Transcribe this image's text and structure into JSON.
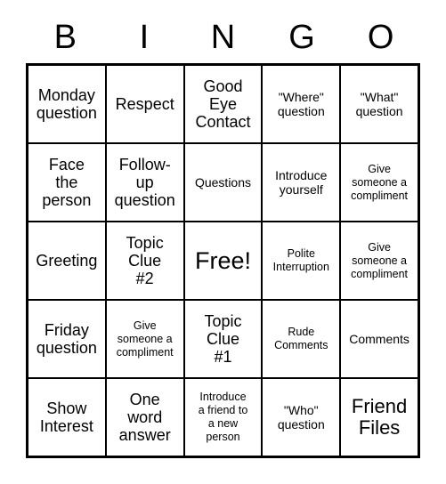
{
  "card": {
    "title": "BINGO",
    "headers": [
      "B",
      "I",
      "N",
      "G",
      "O"
    ],
    "rows": [
      [
        {
          "text": "Monday\nquestion",
          "size": "md"
        },
        {
          "text": "Respect",
          "size": "md"
        },
        {
          "text": "Good\nEye\nContact",
          "size": "md"
        },
        {
          "text": "\"Where\"\nquestion",
          "size": "sm"
        },
        {
          "text": "\"What\"\nquestion",
          "size": "sm"
        }
      ],
      [
        {
          "text": "Face\nthe\nperson",
          "size": "md"
        },
        {
          "text": "Follow-\nup\nquestion",
          "size": "md"
        },
        {
          "text": "Questions",
          "size": "sm"
        },
        {
          "text": "Introduce\nyourself",
          "size": "sm"
        },
        {
          "text": "Give\nsomeone a\ncompliment",
          "size": "xs"
        }
      ],
      [
        {
          "text": "Greeting",
          "size": "md"
        },
        {
          "text": "Topic\nClue\n#2",
          "size": "md"
        },
        {
          "text": "Free!",
          "size": "xl"
        },
        {
          "text": "Polite\nInterruption",
          "size": "xs"
        },
        {
          "text": "Give\nsomeone a\ncompliment",
          "size": "xs"
        }
      ],
      [
        {
          "text": "Friday\nquestion",
          "size": "md"
        },
        {
          "text": "Give\nsomeone a\ncompliment",
          "size": "xs"
        },
        {
          "text": "Topic\nClue\n#1",
          "size": "md"
        },
        {
          "text": "Rude\nComments",
          "size": "xs"
        },
        {
          "text": "Comments",
          "size": "sm"
        }
      ],
      [
        {
          "text": "Show\nInterest",
          "size": "md"
        },
        {
          "text": "One\nword\nanswer",
          "size": "md"
        },
        {
          "text": "Introduce\na friend to\na new\nperson",
          "size": "xs"
        },
        {
          "text": "\"Who\"\nquestion",
          "size": "sm"
        },
        {
          "text": "Friend\nFiles",
          "size": "lg"
        }
      ]
    ],
    "colors": {
      "background": "#ffffff",
      "border": "#000000",
      "text": "#000000"
    }
  }
}
